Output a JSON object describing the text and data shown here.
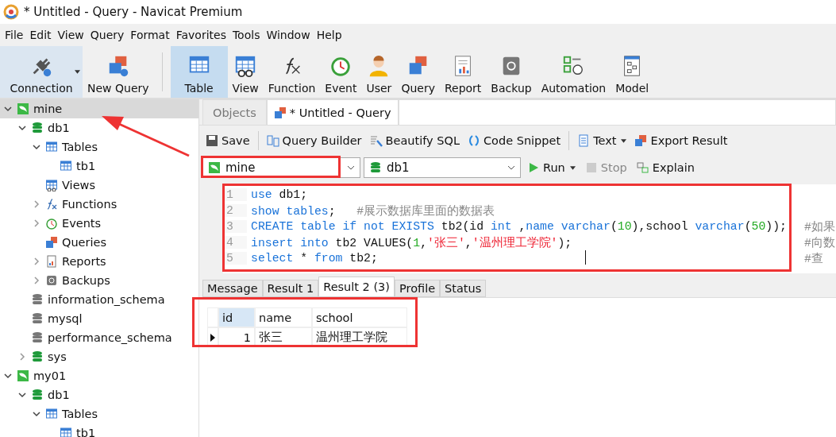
{
  "window": {
    "title": "* Untitled - Query - Navicat Premium"
  },
  "menu": [
    "File",
    "Edit",
    "View",
    "Query",
    "Format",
    "Favorites",
    "Tools",
    "Window",
    "Help"
  ],
  "toolbar": [
    {
      "label": "Connection",
      "kind": "connection",
      "selected": false,
      "hovered": true
    },
    {
      "label": "New Query",
      "kind": "newquery",
      "selected": false,
      "hovered": false
    },
    {
      "label": "Table",
      "kind": "table",
      "selected": true,
      "hovered": false
    },
    {
      "label": "View",
      "kind": "view",
      "selected": false,
      "hovered": false
    },
    {
      "label": "Function",
      "kind": "function",
      "selected": false,
      "hovered": false
    },
    {
      "label": "Event",
      "kind": "event",
      "selected": false,
      "hovered": false
    },
    {
      "label": "User",
      "kind": "user",
      "selected": false,
      "hovered": false
    },
    {
      "label": "Query",
      "kind": "query",
      "selected": false,
      "hovered": false
    },
    {
      "label": "Report",
      "kind": "report",
      "selected": false,
      "hovered": false
    },
    {
      "label": "Backup",
      "kind": "backup",
      "selected": false,
      "hovered": false
    },
    {
      "label": "Automation",
      "kind": "automation",
      "selected": false,
      "hovered": false
    },
    {
      "label": "Model",
      "kind": "model",
      "selected": false,
      "hovered": false
    }
  ],
  "sidebar": {
    "tree": [
      {
        "label": "mine",
        "kind": "connection",
        "selected": true,
        "expanded": true,
        "children": [
          {
            "label": "db1",
            "kind": "database",
            "opened": true,
            "selected": false,
            "expanded": true,
            "children": [
              {
                "label": "Tables",
                "kind": "tables",
                "selected": false,
                "expanded": true,
                "children": [
                  {
                    "label": "tb1",
                    "kind": "table",
                    "selected": false
                  }
                ]
              },
              {
                "label": "Views",
                "kind": "views",
                "selected": false
              },
              {
                "label": "Functions",
                "kind": "functions",
                "selected": false,
                "expanded": false
              },
              {
                "label": "Events",
                "kind": "events",
                "selected": false,
                "expanded": false
              },
              {
                "label": "Queries",
                "kind": "queries",
                "selected": false
              },
              {
                "label": "Reports",
                "kind": "reports",
                "selected": false,
                "expanded": false
              },
              {
                "label": "Backups",
                "kind": "backups",
                "selected": false,
                "expanded": false
              }
            ]
          },
          {
            "label": "information_schema",
            "kind": "database",
            "opened": false,
            "selected": false
          },
          {
            "label": "mysql",
            "kind": "database",
            "opened": false,
            "selected": false
          },
          {
            "label": "performance_schema",
            "kind": "database",
            "opened": false,
            "selected": false
          },
          {
            "label": "sys",
            "kind": "database",
            "opened": true,
            "selected": false,
            "expanded": false
          }
        ]
      },
      {
        "label": "my01",
        "kind": "connection",
        "selected": false,
        "expanded": true,
        "children": [
          {
            "label": "db1",
            "kind": "database",
            "opened": true,
            "selected": false,
            "expanded": true,
            "children": [
              {
                "label": "Tables",
                "kind": "tables",
                "selected": false,
                "expanded": true,
                "children": [
                  {
                    "label": "tb1",
                    "kind": "table",
                    "selected": false
                  }
                ]
              }
            ]
          }
        ]
      }
    ]
  },
  "tabs": [
    {
      "label": "Objects",
      "selected": false
    },
    {
      "label": "* Untitled - Query",
      "selected": true
    }
  ],
  "query_toolbar": [
    {
      "label": "Save",
      "kind": "save"
    },
    {
      "label": "Query Builder",
      "kind": "builder"
    },
    {
      "label": "Beautify SQL",
      "kind": "beautify"
    },
    {
      "label": "Code Snippet",
      "kind": "snippet"
    },
    {
      "label": "Text",
      "kind": "text"
    },
    {
      "label": "Export Result",
      "kind": "export"
    }
  ],
  "connection_select": {
    "value": "mine"
  },
  "database_select": {
    "value": "db1"
  },
  "run_buttons": [
    {
      "label": "Run",
      "kind": "run",
      "disabled": false
    },
    {
      "label": "Stop",
      "kind": "stop",
      "disabled": true
    },
    {
      "label": "Explain",
      "kind": "explain",
      "disabled": false
    }
  ],
  "editor": {
    "lines": [
      {
        "number": "1",
        "segments": [
          {
            "kind": "kw",
            "text": "use"
          },
          {
            "kind": "plain",
            "text": " db1;"
          }
        ]
      },
      {
        "number": "2",
        "segments": [
          {
            "kind": "kw",
            "text": "show tables"
          },
          {
            "kind": "plain",
            "text": ";   "
          },
          {
            "kind": "comment",
            "text": "#展示数据库里面的数据表"
          }
        ]
      },
      {
        "number": "3",
        "segments": [
          {
            "kind": "kw",
            "text": "CREATE table if not EXISTS"
          },
          {
            "kind": "plain",
            "text": " tb2(id "
          },
          {
            "kind": "kw",
            "text": "int"
          },
          {
            "kind": "plain",
            "text": " ,"
          },
          {
            "kind": "kw",
            "text": "name varchar"
          },
          {
            "kind": "plain",
            "text": "("
          },
          {
            "kind": "num",
            "text": "10"
          },
          {
            "kind": "plain",
            "text": "),school "
          },
          {
            "kind": "kw",
            "text": "varchar"
          },
          {
            "kind": "plain",
            "text": "("
          },
          {
            "kind": "num",
            "text": "50"
          },
          {
            "kind": "plain",
            "text": "));"
          }
        ],
        "tail_comment": "#如果"
      },
      {
        "number": "4",
        "segments": [
          {
            "kind": "kw",
            "text": "insert into"
          },
          {
            "kind": "plain",
            "text": " tb2 VALUES("
          },
          {
            "kind": "num",
            "text": "1"
          },
          {
            "kind": "plain",
            "text": ","
          },
          {
            "kind": "str",
            "text": "'张三'"
          },
          {
            "kind": "plain",
            "text": ","
          },
          {
            "kind": "str",
            "text": "'温州理工学院'"
          },
          {
            "kind": "plain",
            "text": ");"
          }
        ],
        "tail_comment": "#向数"
      },
      {
        "number": "5",
        "segments": [
          {
            "kind": "kw",
            "text": "select"
          },
          {
            "kind": "plain",
            "text": " * "
          },
          {
            "kind": "kw",
            "text": "from"
          },
          {
            "kind": "plain",
            "text": " tb2;"
          }
        ],
        "tail_comment": "#查"
      }
    ]
  },
  "result_tabs": [
    {
      "label": "Message",
      "selected": false
    },
    {
      "label": "Result 1",
      "selected": false
    },
    {
      "label": "Result 2 (3)",
      "selected": true
    },
    {
      "label": "Profile",
      "selected": false
    },
    {
      "label": "Status",
      "selected": false
    }
  ],
  "table": {
    "columns": [
      {
        "label": "id",
        "selected": true
      },
      {
        "label": "name",
        "selected": false
      },
      {
        "label": "school",
        "selected": false
      }
    ],
    "rows": [
      {
        "current": true,
        "cells": [
          "1",
          "张三",
          "温州理工学院"
        ]
      }
    ]
  }
}
